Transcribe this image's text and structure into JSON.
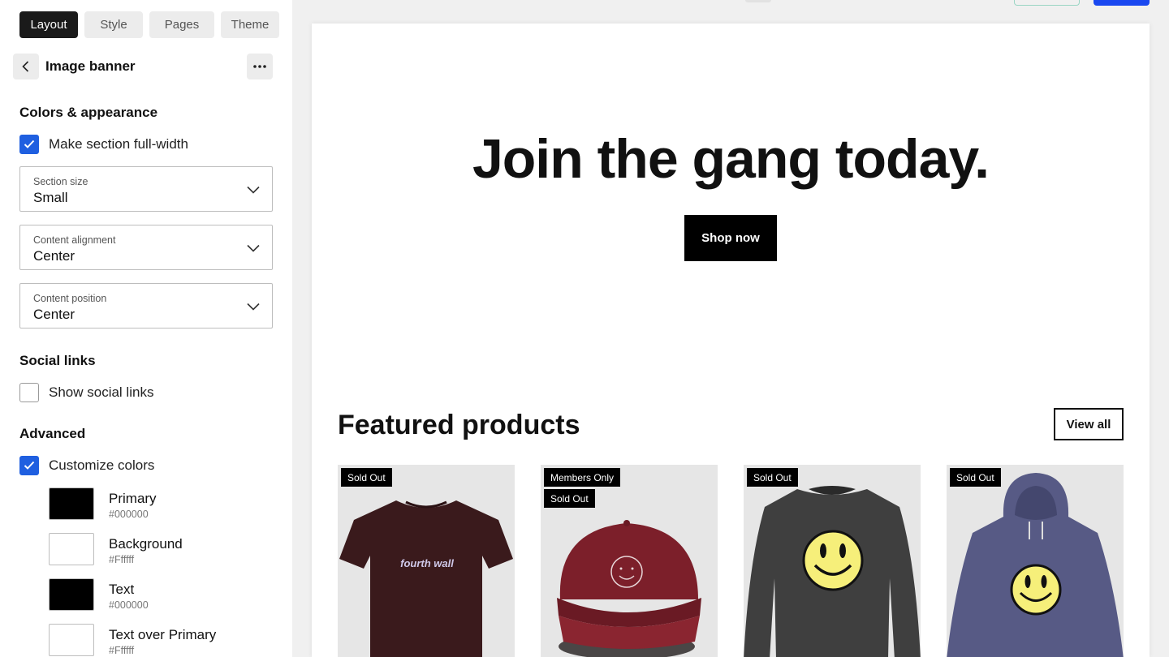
{
  "tabs": [
    {
      "label": "Layout",
      "active": true
    },
    {
      "label": "Style",
      "active": false
    },
    {
      "label": "Pages",
      "active": false
    },
    {
      "label": "Theme",
      "active": false
    }
  ],
  "panel": {
    "title": "Image banner"
  },
  "colors_appearance": {
    "heading": "Colors & appearance",
    "full_width": {
      "label": "Make section full-width",
      "checked": true
    },
    "section_size": {
      "label": "Section size",
      "value": "Small"
    },
    "content_alignment": {
      "label": "Content alignment",
      "value": "Center"
    },
    "content_position": {
      "label": "Content position",
      "value": "Center"
    }
  },
  "social_links": {
    "heading": "Social links",
    "show": {
      "label": "Show social links",
      "checked": false
    }
  },
  "advanced": {
    "heading": "Advanced",
    "customize": {
      "label": "Customize colors",
      "checked": true
    },
    "colors": [
      {
        "name": "Primary",
        "hex": "#000000",
        "swatch": "#000000"
      },
      {
        "name": "Background",
        "hex": "#Ffffff",
        "swatch": "#ffffff"
      },
      {
        "name": "Text",
        "hex": "#000000",
        "swatch": "#000000"
      },
      {
        "name": "Text over Primary",
        "hex": "#Ffffff",
        "swatch": "#ffffff"
      }
    ]
  },
  "preview": {
    "banner_heading": "Join the gang today.",
    "shop_button": "Shop now",
    "featured_title": "Featured products",
    "view_all": "View all",
    "products": [
      {
        "badges": [
          "Sold Out"
        ],
        "item": "t-shirt",
        "print": "fourth wall"
      },
      {
        "badges": [
          "Members Only",
          "Sold Out"
        ],
        "item": "cap"
      },
      {
        "badges": [
          "Sold Out"
        ],
        "item": "sweatshirt"
      },
      {
        "badges": [
          "Sold Out"
        ],
        "item": "hoodie"
      }
    ]
  },
  "accent": "#1f5fe0"
}
